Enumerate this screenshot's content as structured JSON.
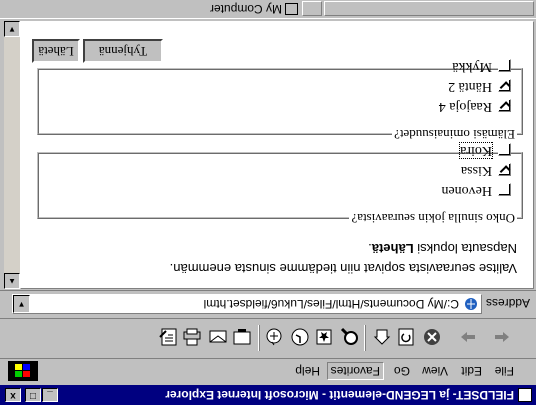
{
  "window": {
    "title": "FIELDSET- ja LEGEND-elementit - Microsoft Internet Explorer",
    "minimize": "_",
    "maximize": "□",
    "close": "x"
  },
  "menu": [
    "File",
    "Edit",
    "View",
    "Go",
    "Favorites",
    "Help"
  ],
  "toolbar_icons": [
    "back-icon",
    "forward-icon",
    "stop-icon",
    "refresh-icon",
    "home-icon",
    "search-icon",
    "favorites-icon",
    "history-icon",
    "channels-icon",
    "fullscreen-icon",
    "mail-icon",
    "print-icon",
    "edit-icon"
  ],
  "address": {
    "label": "Address",
    "value": "C:/My Documents/Html/Files/Luku6/fieldset.html"
  },
  "page": {
    "intro_line1": "Valitse seuraavista sopivat niin tiedämme sinusta enemmän.",
    "intro_line2_prefix": "Napsauta lopuksi ",
    "intro_line2_bold": "Lähetä",
    "intro_line2_suffix": ".",
    "fieldset1": {
      "legend": "Onko sinulla jokin seuraavista?",
      "options": [
        {
          "label": "Hevonen",
          "checked": false
        },
        {
          "label": "Kissa",
          "checked": true
        },
        {
          "label": "Koira",
          "checked": false
        }
      ]
    },
    "fieldset2": {
      "legend": "Elämäsi ominaisuudet?",
      "options": [
        {
          "label": "Raajoja 4",
          "checked": true
        },
        {
          "label": "Häntä 2",
          "checked": true
        },
        {
          "label": "Mykkä",
          "checked": false
        }
      ]
    },
    "buttons": {
      "submit": "Lähetä",
      "reset": "Tyhjennä"
    }
  },
  "status": {
    "zone": "My Computer"
  }
}
